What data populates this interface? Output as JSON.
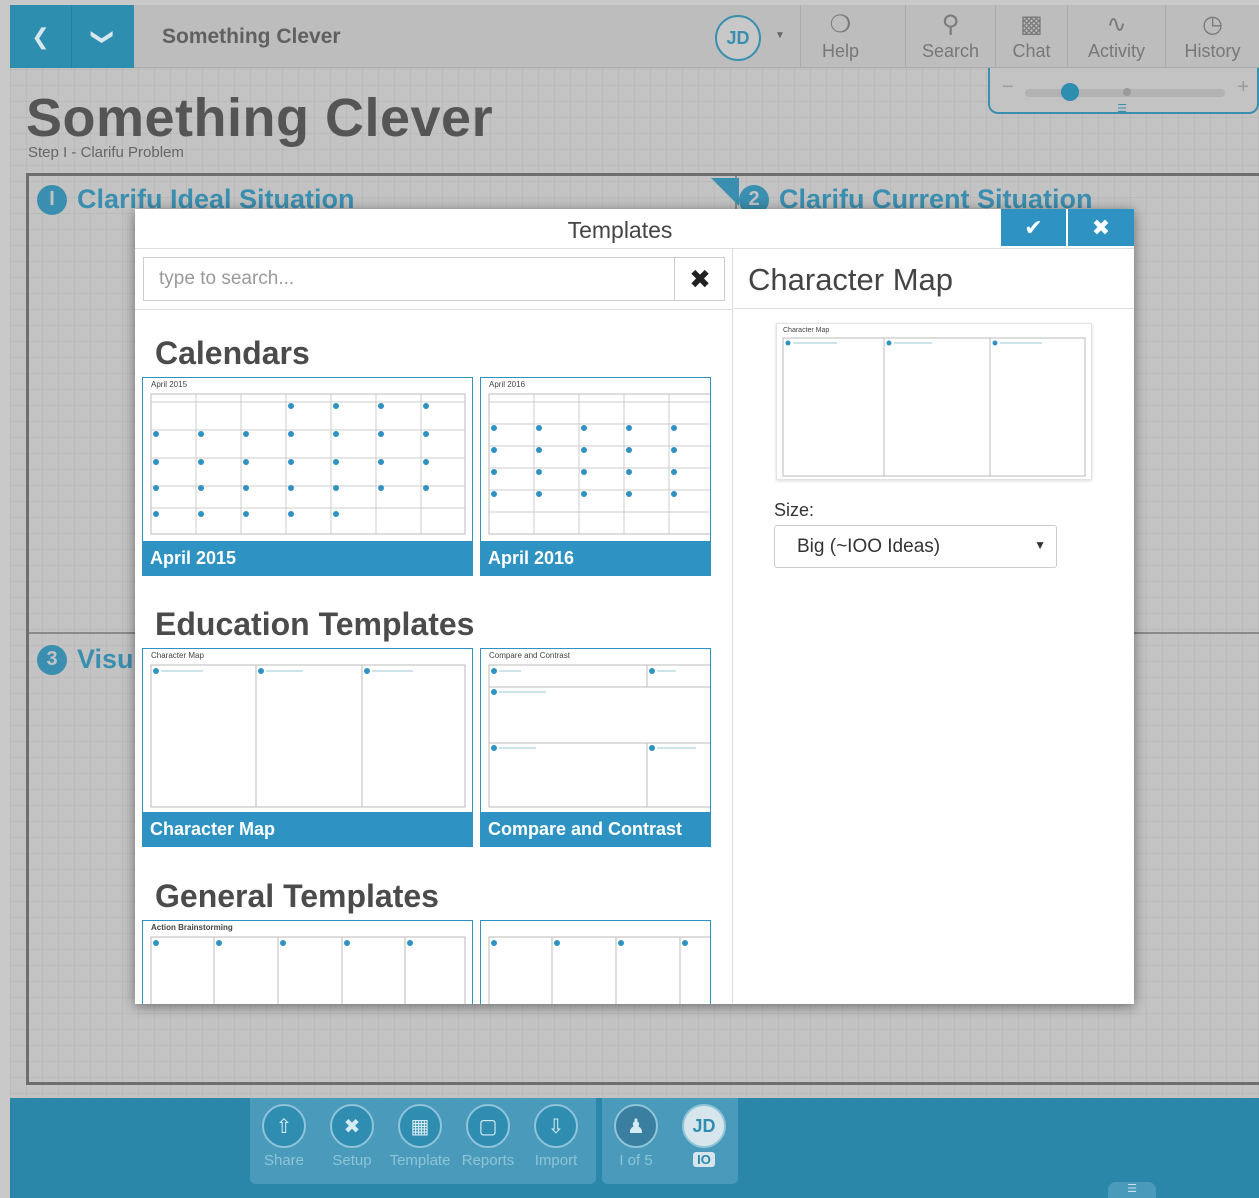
{
  "topbar": {
    "back_icon": "chevron-left-icon",
    "menu_icon": "chevron-down-icon",
    "app_title": "Something Clever",
    "user_initials": "JD",
    "tools": [
      {
        "label": "Help",
        "icon": "lifebuoy-icon"
      },
      {
        "label": "Search",
        "icon": "search-icon"
      },
      {
        "label": "Chat",
        "icon": "chat-icon"
      },
      {
        "label": "Activity",
        "icon": "activity-icon"
      },
      {
        "label": "History",
        "icon": "clock-icon"
      }
    ],
    "zoom": {
      "minus": "−",
      "plus": "+",
      "level": 0.18
    }
  },
  "page": {
    "title": "Something Clever",
    "subtitle": "Step I - Clarifu Problem",
    "quadrants": [
      {
        "number": "I",
        "title": "Clarifu Ideal Situation"
      },
      {
        "number": "2",
        "title": "Clarifu Current Situation"
      },
      {
        "number": "3",
        "title": "Visu"
      }
    ]
  },
  "modal": {
    "title": "Templates",
    "confirm_icon": "check-icon",
    "close_icon": "close-icon",
    "search": {
      "placeholder": "type to search...",
      "value": "",
      "clear_icon": "close-icon"
    },
    "sections": [
      {
        "title": "Calendars",
        "cards": [
          {
            "label": "April 2015",
            "thumb_title": "April 2015"
          },
          {
            "label": "April 2016",
            "thumb_title": "April 2016"
          }
        ]
      },
      {
        "title": "Education Templates",
        "cards": [
          {
            "label": "Character Map",
            "thumb_title": "Character Map"
          },
          {
            "label": "Compare and Contrast",
            "thumb_title": "Compare and Contrast"
          }
        ]
      },
      {
        "title": "General Templates",
        "cards": [
          {
            "label": "",
            "thumb_title": "Action Brainstorming"
          },
          {
            "label": "",
            "thumb_title": ""
          }
        ]
      }
    ],
    "preview": {
      "title": "Character Map",
      "thumb_title": "Character Map",
      "size_label": "Size:",
      "size_value": "Big (~IOO Ideas)"
    }
  },
  "bottombar": {
    "tools": [
      {
        "label": "Share",
        "icon": "share-icon"
      },
      {
        "label": "Setup",
        "icon": "tools-icon"
      },
      {
        "label": "Template",
        "icon": "template-icon"
      },
      {
        "label": "Reports",
        "icon": "reports-icon"
      },
      {
        "label": "Import",
        "icon": "import-icon"
      }
    ],
    "participants": {
      "label": "I of 5",
      "icon": "person-icon"
    },
    "user": {
      "initials": "JD",
      "badge": "IO"
    }
  },
  "colors": {
    "accent": "#2e92c2",
    "topbar_accent": "#2d8eaf",
    "bottombar": "#2b87a9"
  }
}
